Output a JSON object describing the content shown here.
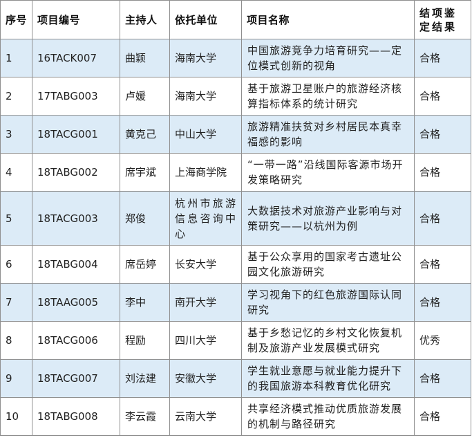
{
  "table": {
    "headers": {
      "seq": "序号",
      "code": "项目编号",
      "host": "主持人",
      "unit": "依托单位",
      "name": "项目名称",
      "result": "结项鉴定结果"
    },
    "rows": [
      {
        "seq": "1",
        "code": "16TACK007",
        "host": "曲颖",
        "unit": "海南大学",
        "name": "中国旅游竞争力培育研究——定位模式创新的视角",
        "result": "合格"
      },
      {
        "seq": "2",
        "code": "17TABG003",
        "host": "卢媛",
        "unit": "海南大学",
        "name": "基于旅游卫星账户的旅游经济核算指标体系的统计研究",
        "result": "合格"
      },
      {
        "seq": "3",
        "code": "18TACG001",
        "host": "黄克己",
        "unit": "中山大学",
        "name": "旅游精准扶贫对乡村居民本真幸福感的影响",
        "result": "合格"
      },
      {
        "seq": "4",
        "code": "18TABG002",
        "host": "席宇斌",
        "unit": "上海商学院",
        "name": "“一带一路”沿线国际客源市场开发策略研究",
        "result": "合格"
      },
      {
        "seq": "5",
        "code": "18TACG003",
        "host": "郑俊",
        "unit": "杭州市旅游信息咨询中心",
        "name": "大数据技术对旅游产业影响与对策研究——以杭州为例",
        "result": "合格"
      },
      {
        "seq": "6",
        "code": "18TABG004",
        "host": "席岳婷",
        "unit": "长安大学",
        "name": "基于公众享用的国家考古遗址公园文化旅游研究",
        "result": "合格"
      },
      {
        "seq": "7",
        "code": "18TAAG005",
        "host": "李中",
        "unit": "南开大学",
        "name": "学习视角下的红色旅游国际认同研究",
        "result": "合格"
      },
      {
        "seq": "8",
        "code": "18TACG006",
        "host": "程励",
        "unit": "四川大学",
        "name": "基于乡愁记忆的乡村文化恢复机制及旅游产业发展模式研究",
        "result": "优秀"
      },
      {
        "seq": "9",
        "code": "18TACG007",
        "host": "刘法建",
        "unit": "安徽大学",
        "name": "学生就业意愿与就业能力提升下的我国旅游本科教育优化研究",
        "result": "合格"
      },
      {
        "seq": "10",
        "code": "18TABG008",
        "host": "李云霞",
        "unit": "云南大学",
        "name": "共享经济模式推动优质旅游发展的机制与路径研究",
        "result": "合格"
      }
    ]
  }
}
